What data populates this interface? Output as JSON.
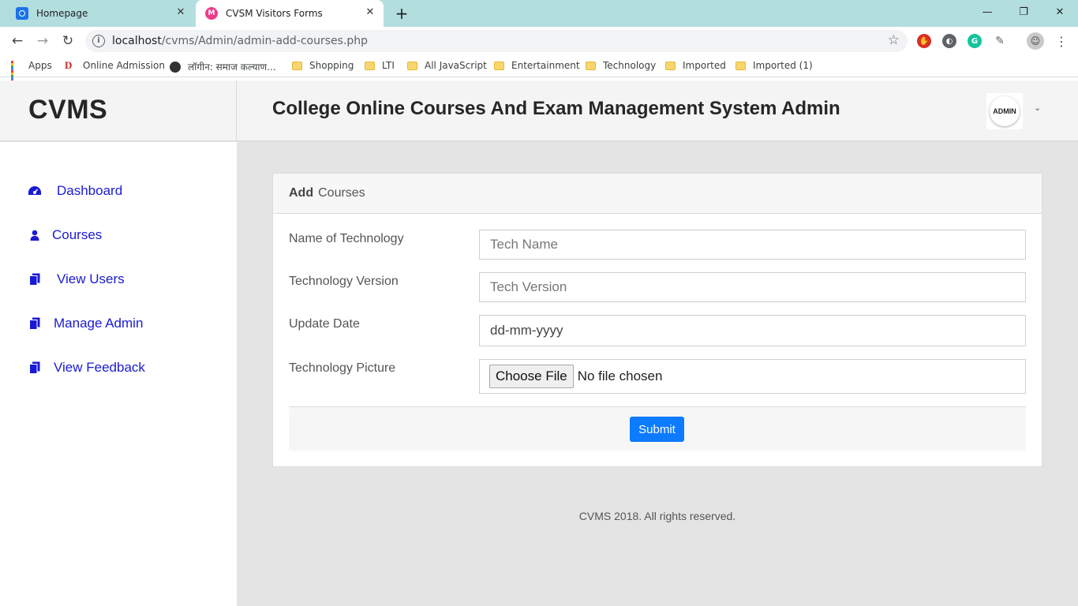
{
  "browser": {
    "tabs": [
      {
        "title": "Homepage",
        "icon": "search-favicon"
      },
      {
        "title": "CVSM Visitors Forms",
        "icon": "cvsm-favicon",
        "active": true
      }
    ],
    "close_glyph": "✕",
    "new_tab_glyph": "+",
    "window_controls": {
      "minimize": "—",
      "restore": "❐",
      "close": "✕"
    },
    "nav": {
      "back": "←",
      "forward": "→",
      "reload": "↻"
    },
    "url_host": "localhost",
    "url_path": "/cvms/Admin/admin-add-courses.php",
    "info_glyph": "i",
    "star_glyph": "☆",
    "menu_glyph": "⋮",
    "bookmarks": [
      {
        "label": "Apps",
        "icon": "apps-grid-icon"
      },
      {
        "label": "Online Admission",
        "icon": "d-logo-icon"
      },
      {
        "label": "लॉगीन: समाज कल्याण...",
        "icon": "globe-icon"
      },
      {
        "label": "Shopping",
        "icon": "folder-icon"
      },
      {
        "label": "LTI",
        "icon": "folder-icon"
      },
      {
        "label": "All JavaScript",
        "icon": "folder-icon"
      },
      {
        "label": "Entertainment",
        "icon": "folder-icon"
      },
      {
        "label": "Technology",
        "icon": "folder-icon"
      },
      {
        "label": "Imported",
        "icon": "folder-icon"
      },
      {
        "label": "Imported (1)",
        "icon": "folder-icon"
      }
    ]
  },
  "app": {
    "brand": "CVMS",
    "title": "College Online Courses And Exam Management System Admin",
    "avatar_text": "ADMIN",
    "caret_glyph": "⌄"
  },
  "sidebar": {
    "items": [
      {
        "label": "Dashboard",
        "icon": "dashboard-icon"
      },
      {
        "label": "Courses",
        "icon": "user-icon"
      },
      {
        "label": "View Users",
        "icon": "copy-icon"
      },
      {
        "label": "Manage Admin",
        "icon": "copy-icon"
      },
      {
        "label": "View Feedback",
        "icon": "copy-icon"
      }
    ]
  },
  "form": {
    "header_bold": "Add",
    "header_rest": "Courses",
    "fields": [
      {
        "label": "Name of Technology",
        "placeholder": "Tech Name"
      },
      {
        "label": "Technology Version",
        "placeholder": "Tech Version"
      },
      {
        "label": "Update Date",
        "placeholder": "dd-mm-yyyy"
      },
      {
        "label": "Technology Picture",
        "button": "Choose File",
        "status": "No file chosen"
      }
    ],
    "submit": "Submit"
  },
  "footer": "CVMS 2018. All rights reserved.",
  "colors": {
    "link": "#1a1ad6",
    "primary": "#0d7bff",
    "tabstrip": "#b3dede"
  }
}
